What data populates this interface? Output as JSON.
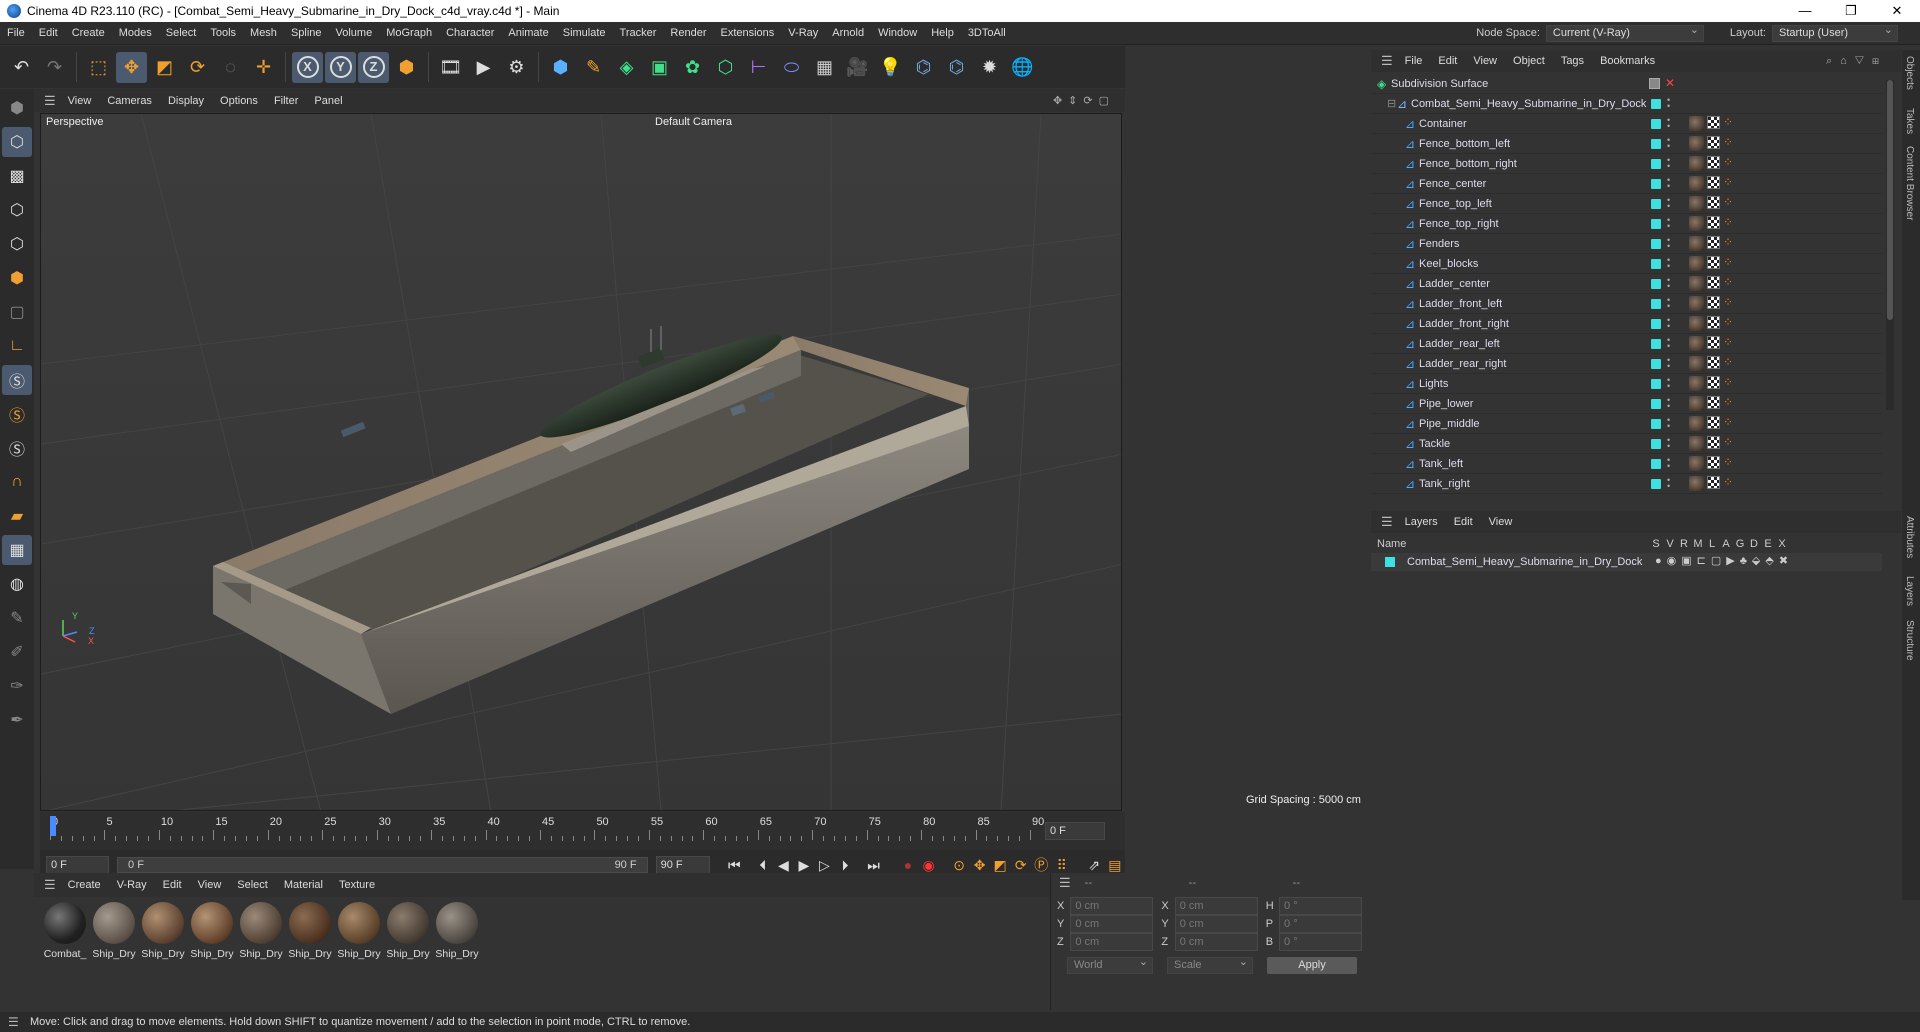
{
  "window": {
    "title": "Cinema 4D R23.110 (RC) - [Combat_Semi_Heavy_Submarine_in_Dry_Dock_c4d_vray.c4d *] - Main",
    "controls": [
      "—",
      "❐",
      "✕"
    ]
  },
  "menubar": {
    "items": [
      "File",
      "Edit",
      "Create",
      "Modes",
      "Select",
      "Tools",
      "Mesh",
      "Spline",
      "Volume",
      "MoGraph",
      "Character",
      "Animate",
      "Simulate",
      "Tracker",
      "Render",
      "Extensions",
      "V-Ray",
      "Arnold",
      "Window",
      "Help",
      "3DToAll"
    ],
    "node_space_label": "Node Space:",
    "node_space_value": "Current (V-Ray)",
    "layout_label": "Layout:",
    "layout_value": "Startup (User)"
  },
  "viewport": {
    "menu": [
      "View",
      "Cameras",
      "Display",
      "Options",
      "Filter",
      "Panel"
    ],
    "label": "Perspective",
    "camera": "Default Camera",
    "grid_spacing": "Grid Spacing : 5000 cm",
    "axes": {
      "y": "Y",
      "z": "Z",
      "x": "X"
    }
  },
  "timeline": {
    "ticks": [
      "0",
      "5",
      "10",
      "15",
      "20",
      "25",
      "30",
      "35",
      "40",
      "45",
      "50",
      "55",
      "60",
      "65",
      "70",
      "75",
      "80",
      "85",
      "90"
    ],
    "current_frame": "0 F",
    "start_field": "0 F",
    "range_start": "0 F",
    "range_end": "90 F",
    "end_field": "90 F"
  },
  "materials": {
    "menu": [
      "Create",
      "V-Ray",
      "Edit",
      "View",
      "Select",
      "Material",
      "Texture"
    ],
    "items": [
      "Combat_",
      "Ship_Dry",
      "Ship_Dry",
      "Ship_Dry",
      "Ship_Dry",
      "Ship_Dry",
      "Ship_Dry",
      "Ship_Dry",
      "Ship_Dry"
    ]
  },
  "coordinates": {
    "headers": [
      "--",
      "--",
      "--"
    ],
    "rows": [
      {
        "a": "X",
        "av": "0 cm",
        "b": "X",
        "bv": "0 cm",
        "c": "H",
        "cv": "0 °"
      },
      {
        "a": "Y",
        "av": "0 cm",
        "b": "Y",
        "bv": "0 cm",
        "c": "P",
        "cv": "0 °"
      },
      {
        "a": "Z",
        "av": "0 cm",
        "b": "Z",
        "bv": "0 cm",
        "c": "B",
        "cv": "0 °"
      }
    ],
    "world": "World",
    "scale": "Scale",
    "apply": "Apply"
  },
  "objects": {
    "menu": [
      "File",
      "Edit",
      "View",
      "Object",
      "Tags",
      "Bookmarks"
    ],
    "root": "Subdivision Surface",
    "group": "Combat_Semi_Heavy_Submarine_in_Dry_Dock",
    "children": [
      "Container",
      "Fence_bottom_left",
      "Fence_bottom_right",
      "Fence_center",
      "Fence_top_left",
      "Fence_top_right",
      "Fenders",
      "Keel_blocks",
      "Ladder_center",
      "Ladder_front_left",
      "Ladder_front_right",
      "Ladder_rear_left",
      "Ladder_rear_right",
      "Lights",
      "Pipe_lower",
      "Pipe_middle",
      "Tackle",
      "Tank_left",
      "Tank_right"
    ]
  },
  "layers": {
    "menu": [
      "Layers",
      "Edit",
      "View"
    ],
    "name_col": "Name",
    "flag_cols": [
      "S",
      "V",
      "R",
      "M",
      "L",
      "A",
      "G",
      "D",
      "E",
      "X"
    ],
    "row": "Combat_Semi_Heavy_Submarine_in_Dry_Dock"
  },
  "side_tabs": [
    "Objects",
    "Takes",
    "Content Browser",
    "Attributes",
    "Layers",
    "Structure"
  ],
  "status": "Move: Click and drag to move elements. Hold down SHIFT to quantize movement / add to the selection in point mode, CTRL to remove.",
  "colors": {
    "accent": "#4b5a6e",
    "layer": "#3fe0e0",
    "tag_orange": "#f08a20",
    "icon_blue": "#4aa8ff"
  }
}
